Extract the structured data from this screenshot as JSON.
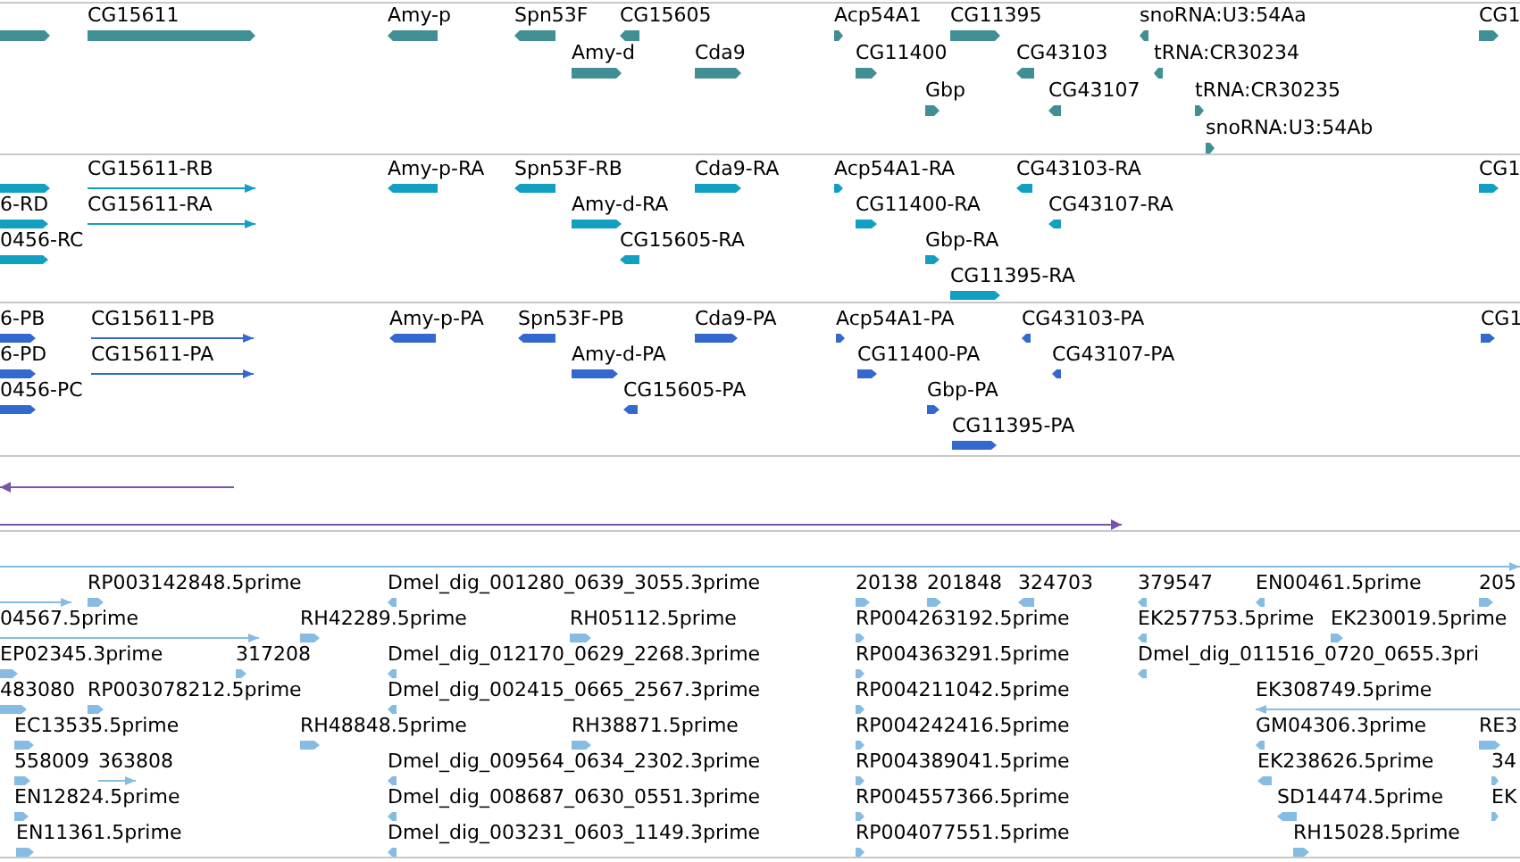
{
  "tracks": [
    {
      "features": [
        {
          "reverse": false
        },
        {
          "label": "CG15611",
          "reverse": false
        },
        {
          "label": "Amy-p",
          "reverse": true
        },
        {
          "label": "Spn53F",
          "reverse": true
        },
        {
          "label": "CG15605",
          "reverse": true
        },
        {
          "label": "Amy-d",
          "reverse": false
        },
        {
          "label": "Cda9",
          "reverse": false
        },
        {
          "label": "Acp54A1",
          "reverse": false
        },
        {
          "label": "CG11395",
          "reverse": false
        },
        {
          "label": "snoRNA:U3:54Aa",
          "reverse": true
        },
        {
          "label": "CG11400",
          "reverse": false
        },
        {
          "label": "CG43103",
          "reverse": true
        },
        {
          "label": "tRNA:CR30234",
          "reverse": true
        },
        {
          "label": "Gbp",
          "reverse": false
        },
        {
          "label": "CG43107",
          "reverse": true
        },
        {
          "label": "tRNA:CR30235",
          "reverse": false
        },
        {
          "label": "snoRNA:U3:54Ab",
          "reverse": false
        },
        {
          "label": "CG1",
          "reverse": false
        }
      ]
    },
    {
      "features": [
        {
          "reverse": false,
          "kind": "block"
        },
        {
          "label": "6-RD",
          "reverse": false,
          "kind": "block"
        },
        {
          "label": "0456-RC",
          "reverse": false,
          "kind": "block"
        },
        {
          "label": "CG15611-RB",
          "reverse": false,
          "kind": "line"
        },
        {
          "label": "CG15611-RA",
          "reverse": false,
          "kind": "line"
        },
        {
          "label": "Amy-p-RA",
          "reverse": true,
          "kind": "block"
        },
        {
          "label": "Spn53F-RB",
          "reverse": true,
          "kind": "block"
        },
        {
          "label": "Cda9-RA",
          "reverse": false,
          "kind": "block"
        },
        {
          "label": "Amy-d-RA",
          "reverse": false,
          "kind": "block"
        },
        {
          "label": "CG15605-RA",
          "reverse": true,
          "kind": "block"
        },
        {
          "label": "Acp54A1-RA",
          "reverse": false,
          "kind": "block"
        },
        {
          "label": "CG43103-RA",
          "reverse": true,
          "kind": "block"
        },
        {
          "label": "CG11400-RA",
          "reverse": false,
          "kind": "block"
        },
        {
          "label": "CG43107-RA",
          "reverse": true,
          "kind": "block"
        },
        {
          "label": "Gbp-RA",
          "reverse": false,
          "kind": "block"
        },
        {
          "label": "CG11395-RA",
          "reverse": false,
          "kind": "block"
        },
        {
          "label": "CG1",
          "reverse": false,
          "kind": "block"
        }
      ]
    },
    {
      "features": [
        {
          "label": "6-PB",
          "reverse": false,
          "kind": "block"
        },
        {
          "label": "6-PD",
          "reverse": false,
          "kind": "block"
        },
        {
          "label": "0456-PC",
          "reverse": false,
          "kind": "block"
        },
        {
          "label": "CG15611-PB",
          "reverse": false,
          "kind": "line"
        },
        {
          "label": "CG15611-PA",
          "reverse": false,
          "kind": "line"
        },
        {
          "label": "Amy-p-PA",
          "reverse": true,
          "kind": "block"
        },
        {
          "label": "Spn53F-PB",
          "reverse": true,
          "kind": "block"
        },
        {
          "label": "Cda9-PA",
          "reverse": false,
          "kind": "block"
        },
        {
          "label": "Amy-d-PA",
          "reverse": false,
          "kind": "block"
        },
        {
          "label": "CG15605-PA",
          "reverse": true,
          "kind": "block"
        },
        {
          "label": "Acp54A1-PA",
          "reverse": false,
          "kind": "block"
        },
        {
          "label": "CG43103-PA",
          "reverse": true,
          "kind": "block"
        },
        {
          "label": "CG11400-PA",
          "reverse": false,
          "kind": "block"
        },
        {
          "label": "CG43107-PA",
          "reverse": true,
          "kind": "block"
        },
        {
          "label": "Gbp-PA",
          "reverse": false,
          "kind": "block"
        },
        {
          "label": "CG11395-PA",
          "reverse": false,
          "kind": "block"
        },
        {
          "label": "CG1",
          "reverse": false,
          "kind": "block"
        }
      ]
    },
    {
      "features": [
        {
          "reverse": true,
          "kind": "line"
        },
        {
          "reverse": false,
          "kind": "line"
        }
      ]
    },
    {
      "features": [
        {
          "reverse": false,
          "kind": "line"
        },
        {
          "reverse": false,
          "kind": "line"
        },
        {
          "label": "RP003142848.5prime",
          "reverse": false,
          "kind": "block"
        },
        {
          "label": "Dmel_dig_001280_0639_3055.3prime",
          "reverse": true,
          "kind": "block"
        },
        {
          "label": "20138",
          "reverse": false,
          "kind": "block"
        },
        {
          "label": "201848",
          "reverse": false,
          "kind": "block"
        },
        {
          "label": "324703",
          "reverse": true,
          "kind": "block"
        },
        {
          "label": "379547",
          "reverse": true,
          "kind": "block"
        },
        {
          "label": "EN00461.5prime",
          "reverse": true,
          "kind": "block"
        },
        {
          "label": "205",
          "reverse": false,
          "kind": "block"
        },
        {
          "label": "04567.5prime",
          "reverse": false,
          "kind": "line"
        },
        {
          "label": "RH42289.5prime",
          "reverse": false,
          "kind": "block"
        },
        {
          "label": "RH05112.5prime",
          "reverse": false,
          "kind": "block"
        },
        {
          "label": "RP004263192.5prime",
          "reverse": false,
          "kind": "block"
        },
        {
          "label": "EK257753.5prime",
          "reverse": true,
          "kind": "block"
        },
        {
          "label": "EK230019.5prime",
          "reverse": false,
          "kind": "block"
        },
        {
          "label": "EP02345.3prime",
          "reverse": false,
          "kind": "block"
        },
        {
          "label": "317208",
          "reverse": false,
          "kind": "block"
        },
        {
          "label": "Dmel_dig_012170_0629_2268.3prime",
          "reverse": true,
          "kind": "block"
        },
        {
          "label": "RP004363291.5prime",
          "reverse": false,
          "kind": "block"
        },
        {
          "label": "Dmel_dig_011516_0720_0655.3pri",
          "reverse": true,
          "kind": "block"
        },
        {
          "label": "483080",
          "reverse": false,
          "kind": "block"
        },
        {
          "label": "RP003078212.5prime",
          "reverse": false,
          "kind": "block"
        },
        {
          "label": "Dmel_dig_002415_0665_2567.3prime",
          "reverse": true,
          "kind": "block"
        },
        {
          "label": "RP004211042.5prime",
          "reverse": false,
          "kind": "block"
        },
        {
          "label": "EK308749.5prime",
          "reverse": true,
          "kind": "line"
        },
        {
          "label": "EC13535.5prime",
          "reverse": false,
          "kind": "block"
        },
        {
          "label": "RH48848.5prime",
          "reverse": false,
          "kind": "block"
        },
        {
          "label": "RH38871.5prime",
          "reverse": false,
          "kind": "block"
        },
        {
          "label": "RP004242416.5prime",
          "reverse": false,
          "kind": "block"
        },
        {
          "label": "GM04306.3prime",
          "reverse": true,
          "kind": "block"
        },
        {
          "label": "RE3",
          "reverse": false,
          "kind": "block"
        },
        {
          "label": "558009",
          "reverse": false,
          "kind": "block"
        },
        {
          "label": "363808",
          "reverse": false,
          "kind": "line"
        },
        {
          "label": "Dmel_dig_009564_0634_2302.3prime",
          "reverse": true,
          "kind": "block"
        },
        {
          "label": "RP004389041.5prime",
          "reverse": false,
          "kind": "block"
        },
        {
          "label": "EK238626.5prime",
          "reverse": true,
          "kind": "block"
        },
        {
          "label": "34",
          "reverse": false,
          "kind": "block"
        },
        {
          "label": "EN12824.5prime",
          "reverse": false,
          "kind": "block"
        },
        {
          "label": "Dmel_dig_008687_0630_0551.3prime",
          "reverse": true,
          "kind": "block"
        },
        {
          "label": "RP004557366.5prime",
          "reverse": false,
          "kind": "block"
        },
        {
          "label": "SD14474.5prime",
          "reverse": true,
          "kind": "block"
        },
        {
          "label": "EK",
          "reverse": false,
          "kind": "block"
        },
        {
          "label": "EN11361.5prime",
          "reverse": false,
          "kind": "block"
        },
        {
          "label": "Dmel_dig_003231_0603_1149.3prime",
          "reverse": true,
          "kind": "block"
        },
        {
          "label": "RP004077551.5prime",
          "reverse": false,
          "kind": "block"
        },
        {
          "label": "RH15028.5prime",
          "reverse": false,
          "kind": "block"
        }
      ]
    }
  ]
}
